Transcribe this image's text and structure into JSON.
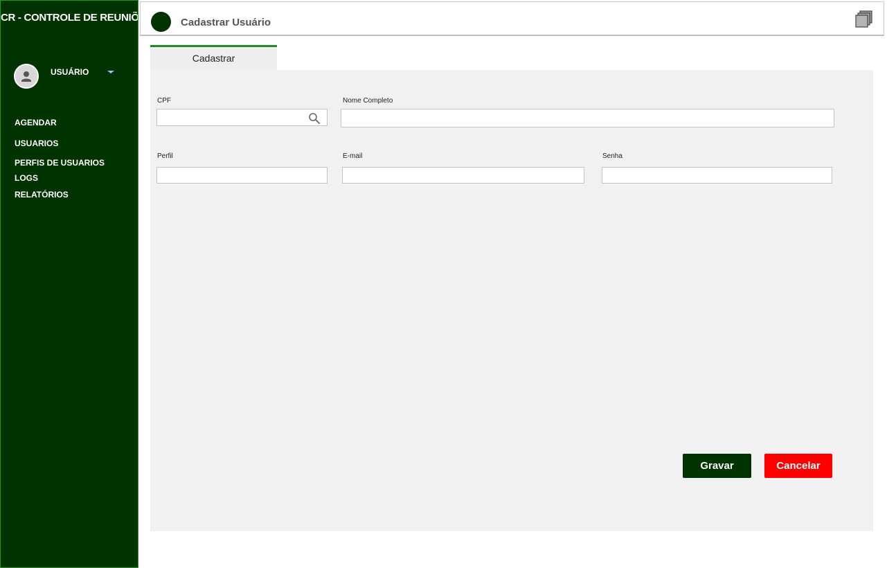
{
  "sidebar": {
    "app_title": "CR - CONTROLE DE REUNIÕES",
    "user_name": "USUÁRIO",
    "nav": [
      "AGENDAR",
      "USUARIOS",
      "PERFIS DE USUARIOS",
      "LOGS",
      "RELATÓRIOS"
    ]
  },
  "header": {
    "title": "Cadastrar Usuário",
    "icon": "stacked-windows-icon"
  },
  "tabs": [
    {
      "label": "Cadastrar"
    }
  ],
  "form": {
    "cpf": {
      "label": "CPF",
      "value": "",
      "placeholder": ""
    },
    "nome": {
      "label": "Nome Completo",
      "value": "",
      "placeholder": ""
    },
    "perfil": {
      "label": "Perfil",
      "value": "",
      "placeholder": ""
    },
    "email": {
      "label": "E-mail",
      "value": "",
      "placeholder": ""
    },
    "senha": {
      "label": "Senha",
      "value": "",
      "placeholder": ""
    }
  },
  "actions": {
    "save_label": "Gravar",
    "cancel_label": "Cancelar"
  },
  "colors": {
    "sidebar_bg": "#003300",
    "accent": "#1e8c1e",
    "save_bg": "#003300",
    "cancel_bg": "#ff0000",
    "panel_bg": "#f1f1f1"
  }
}
